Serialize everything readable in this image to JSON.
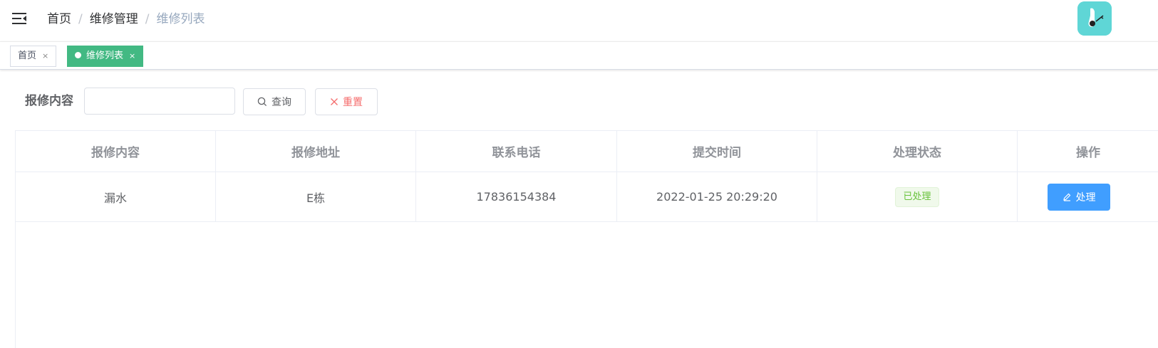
{
  "header": {
    "menu_icon": "hamburger-fold-icon",
    "breadcrumb": [
      "首页",
      "维修管理",
      "维修列表"
    ],
    "separator": "/",
    "avatar_icon": "user-avatar-icon"
  },
  "tags": [
    {
      "label": "首页",
      "close": "×",
      "active": false
    },
    {
      "label": "维修列表",
      "close": "×",
      "active": true
    }
  ],
  "search": {
    "label": "报修内容",
    "input_value": "",
    "input_placeholder": "",
    "search_button": "查询",
    "search_icon": "search-icon",
    "reset_button": "重置",
    "reset_icon": "close-icon"
  },
  "table": {
    "columns": [
      "报修内容",
      "报修地址",
      "联系电话",
      "提交时间",
      "处理状态",
      "操作"
    ],
    "rows": [
      {
        "content": "漏水",
        "address": "E栋",
        "phone": "17836154384",
        "time": "2022-01-25 20:29:20",
        "status": "已处理",
        "action": "处理"
      }
    ]
  },
  "colors": {
    "tag_active": "#42b983",
    "primary": "#409eff",
    "danger": "#f56c6c",
    "success": "#67c23a",
    "avatar_bg": "#5fd6d6"
  }
}
